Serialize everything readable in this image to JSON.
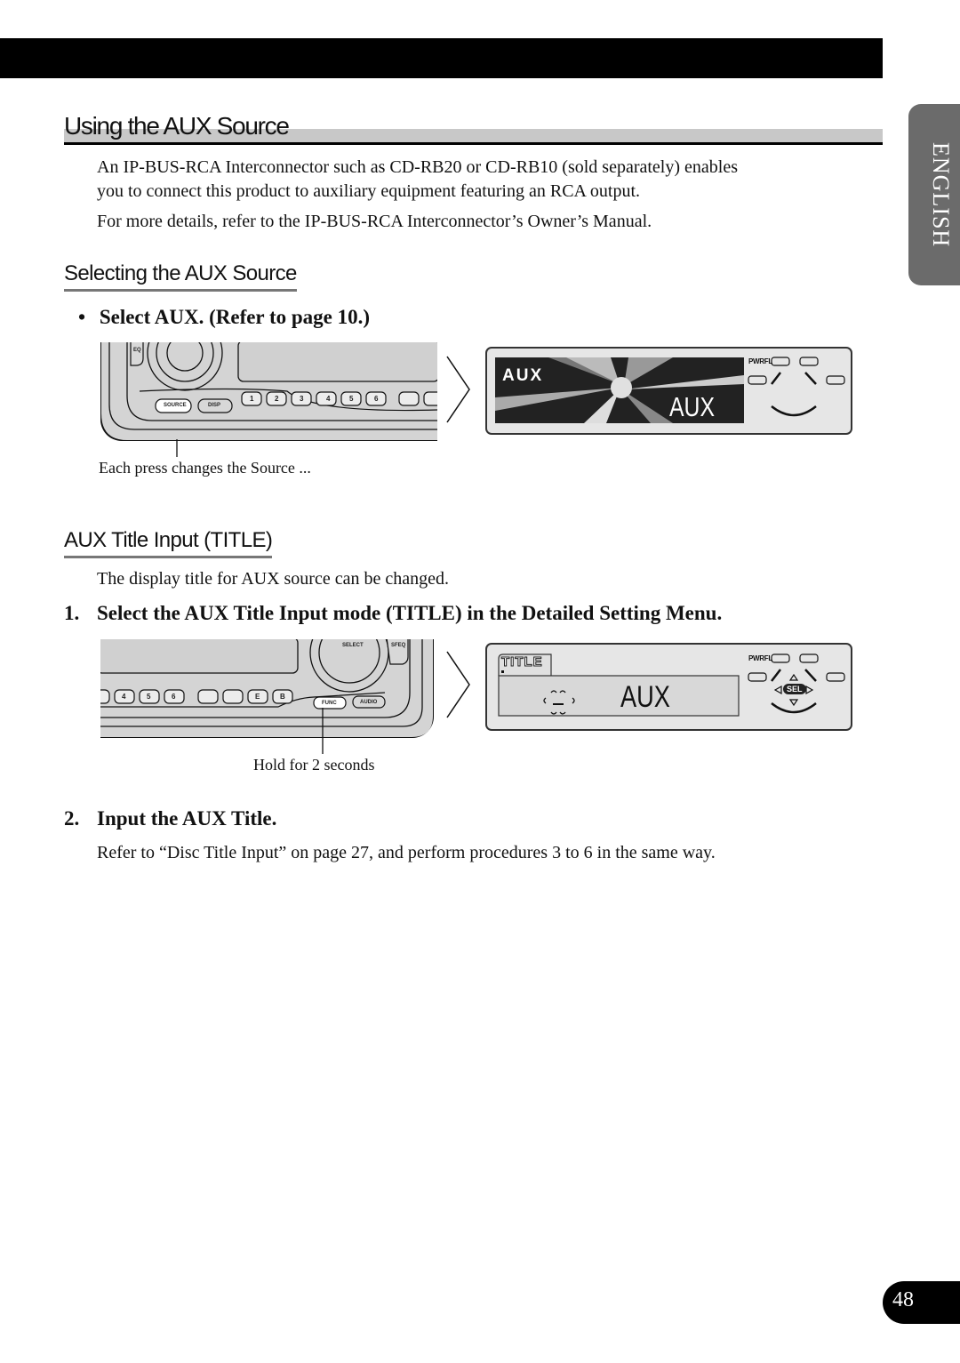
{
  "header": {
    "title": "Using the AUX Source"
  },
  "language_tab": {
    "label": "ENGLISH"
  },
  "intro": {
    "line1": "An IP-BUS-RCA Interconnector such as CD-RB20 or CD-RB10 (sold separately) enables",
    "line2": "you to connect this product to auxiliary equipment featuring an RCA output.",
    "line3": "For more details, refer to the IP-BUS-RCA Interconnector’s Owner’s Manual."
  },
  "section_select": {
    "title": "Selecting the AUX Source",
    "step_bullet": "•",
    "step": "Select AUX. (Refer to page 10.)",
    "illustration": {
      "buttons": [
        "1",
        "2",
        "3",
        "4",
        "5",
        "6"
      ],
      "eq_label": "EQ",
      "source_label": "SOURCE",
      "disp_label": "DISP",
      "caption": "Each press changes the Source ..."
    },
    "display": {
      "small_text": "AUX",
      "large_text": "AUX",
      "indicator": "PWRFL"
    }
  },
  "section_title": {
    "title": "AUX Title Input (TITLE)",
    "description": "The display title for AUX source can be changed.",
    "step1_num": "1.",
    "step1": "Select the AUX Title Input mode (TITLE) in the Detailed Setting Menu.",
    "illustration": {
      "buttons": [
        "4",
        "5",
        "6",
        "E",
        "B"
      ],
      "select_label": "SELECT",
      "sfeq_label": "SFEQ",
      "func_label": "FUNC",
      "audio_label": "AUDIO",
      "caption": "Hold for 2 seconds"
    },
    "display": {
      "tab_text": "TITLE",
      "main_text": "AUX",
      "indicator": "PWRFL",
      "sel_label": "SEL"
    },
    "step2_num": "2.",
    "step2": "Input the AUX Title.",
    "step2_desc": "Refer to “Disc Title Input” on page 27, and perform procedures 3 to 6 in the same way."
  },
  "footer": {
    "page_number": "48"
  }
}
